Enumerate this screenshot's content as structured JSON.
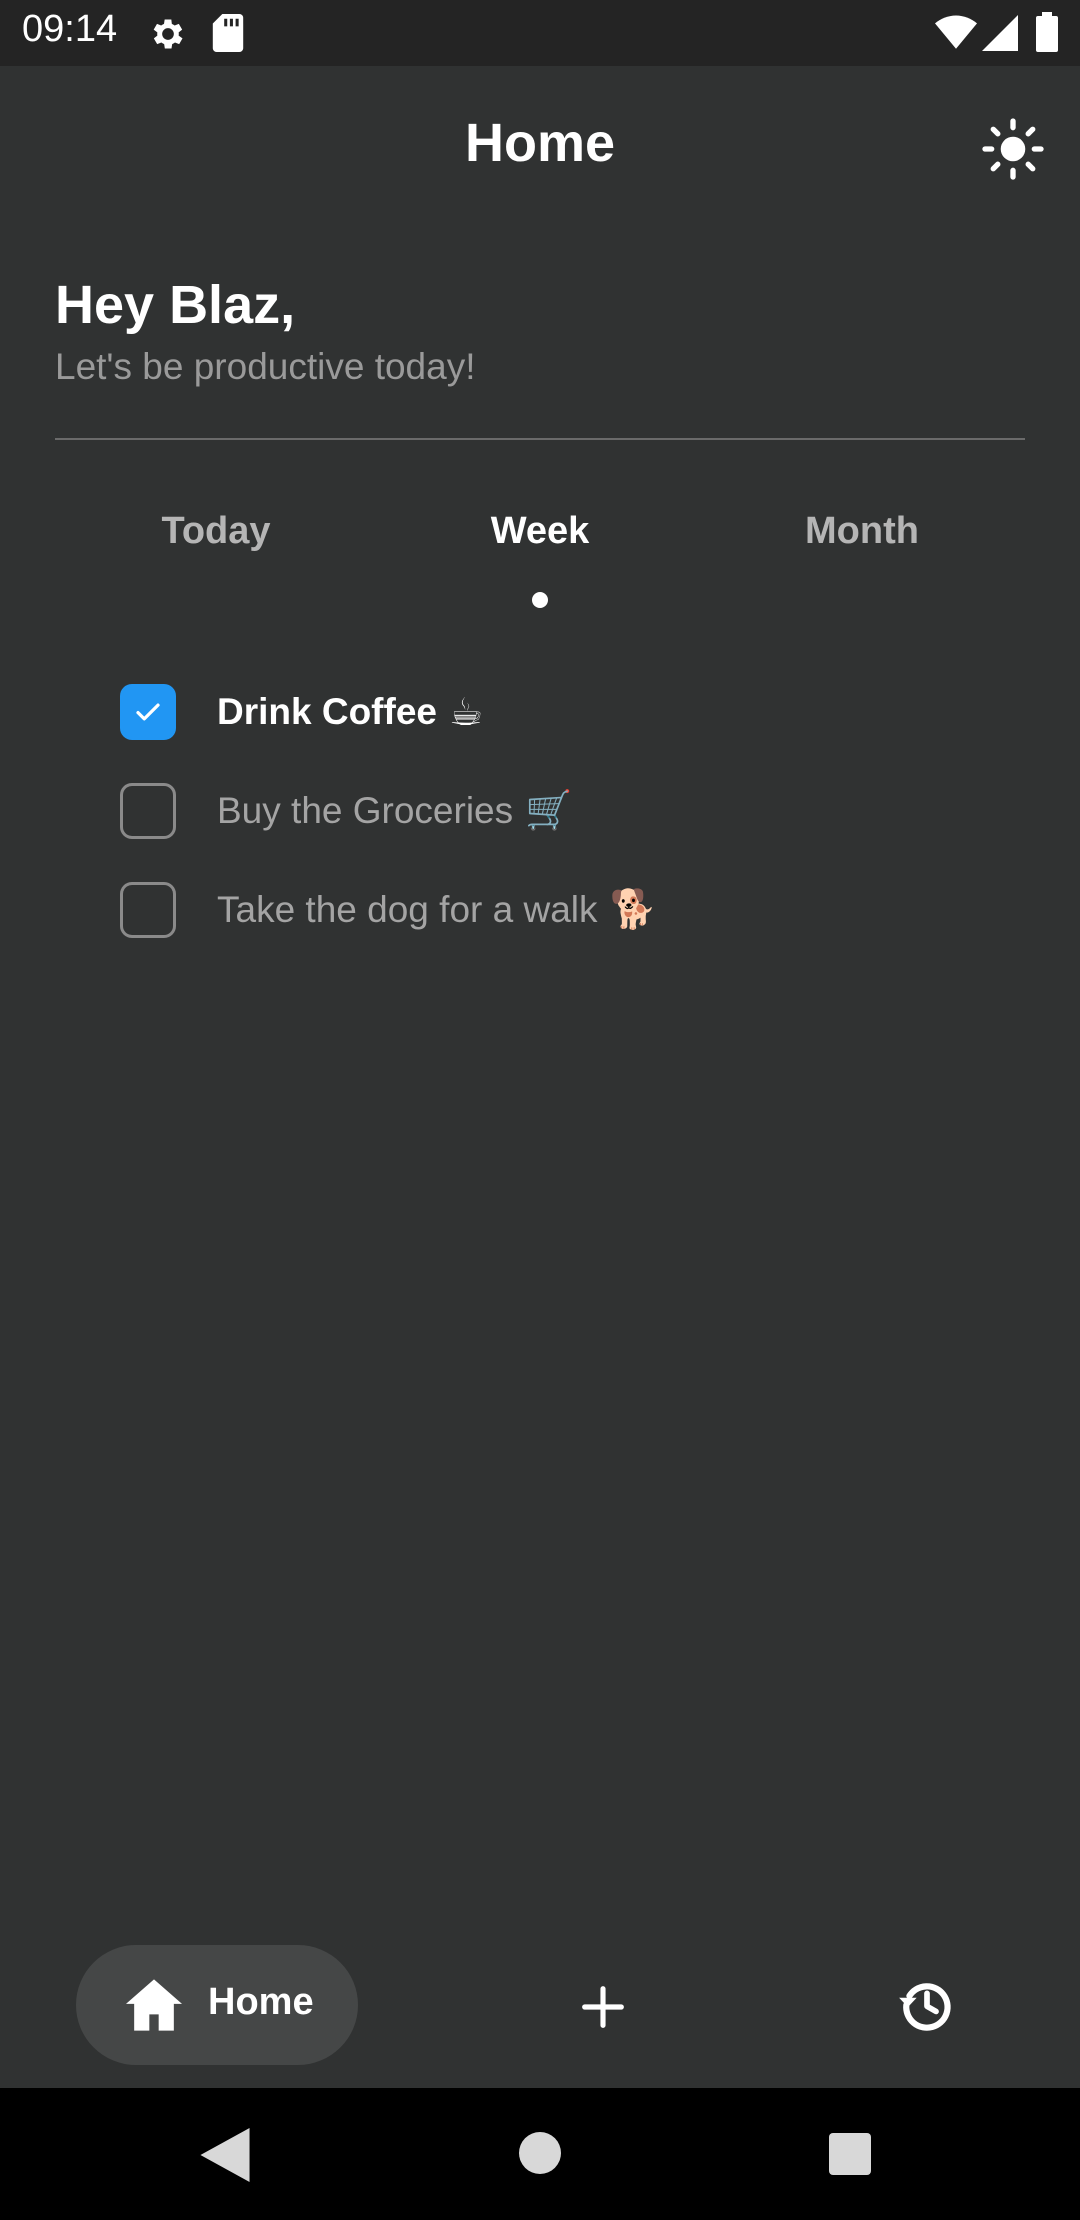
{
  "status_bar": {
    "time": "09:14",
    "icons": [
      "gear-icon",
      "sd-card-icon",
      "wifi-icon",
      "signal-icon",
      "battery-icon"
    ]
  },
  "app_bar": {
    "title": "Home",
    "theme_toggle_icon": "sun-icon"
  },
  "greeting": {
    "title": "Hey Blaz,",
    "subtitle": "Let's be productive today!"
  },
  "tabs": [
    {
      "label": "Today",
      "active": false
    },
    {
      "label": "Week",
      "active": true
    },
    {
      "label": "Month",
      "active": false
    }
  ],
  "tasks": [
    {
      "label": "Drink Coffee",
      "emoji": "☕",
      "checked": true
    },
    {
      "label": "Buy the Groceries",
      "emoji": "🛒",
      "checked": false
    },
    {
      "label": "Take the dog for a walk",
      "emoji": "🐕",
      "checked": false
    }
  ],
  "bottom_nav": {
    "home_label": "Home",
    "home_icon": "home-icon",
    "add_icon": "plus-icon",
    "history_icon": "history-icon"
  },
  "colors": {
    "background": "#303232",
    "status_bar": "#242424",
    "accent": "#2196f3",
    "nav_pill": "#454747"
  }
}
